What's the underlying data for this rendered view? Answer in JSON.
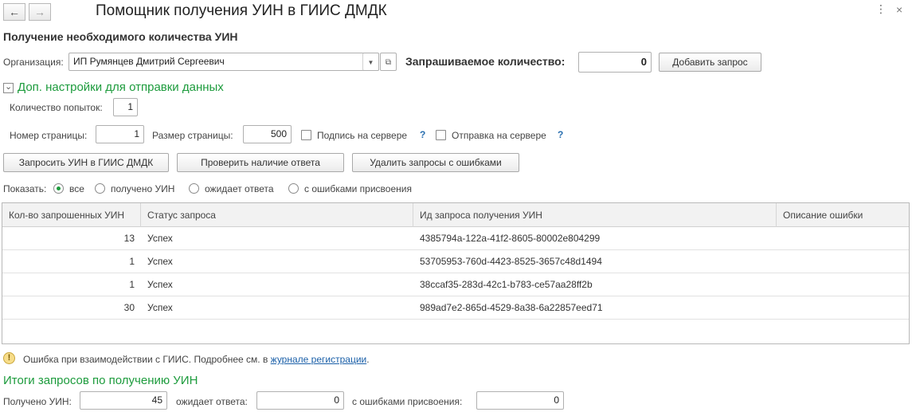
{
  "window": {
    "title": "Помощник получения УИН в ГИИС ДМДК",
    "back_icon": "arrow-left-icon",
    "forward_icon": "arrow-right-icon",
    "menu_icon": "more-vertical-icon",
    "close_icon": "close-icon"
  },
  "section": {
    "title": "Получение необходимого количества УИН"
  },
  "org": {
    "label": "Организация:",
    "value": "ИП Румянцев Дмитрий Сергеевич"
  },
  "request": {
    "qty_label": "Запрашиваемое количество:",
    "qty_value": "0",
    "add_button": "Добавить запрос"
  },
  "settings": {
    "toggle_label": "Доп. настройки для отправки данных",
    "attempts_label": "Количество попыток:",
    "attempts_value": "1",
    "page_num_label": "Номер страницы:",
    "page_num_value": "1",
    "page_size_label": "Размер страницы:",
    "page_size_value": "500",
    "sign_on_server_label": "Подпись на сервере",
    "send_on_server_label": "Отправка на сервере",
    "help_mark": "?"
  },
  "actions": {
    "request_uin": "Запросить УИН в ГИИС ДМДК",
    "check_response": "Проверить наличие ответа",
    "delete_errors": "Удалить запросы с ошибками"
  },
  "filter": {
    "label": "Показать:",
    "options": [
      "все",
      "получено УИН",
      "ожидает ответа",
      "с ошибками присвоения"
    ],
    "selected": "все"
  },
  "table": {
    "columns": [
      "Кол-во запрошенных УИН",
      "Статус запроса",
      "Ид запроса получения УИН",
      "Описание ошибки"
    ],
    "rows": [
      {
        "count": "13",
        "status": "Успех",
        "id": "4385794a-122a-41f2-8605-80002e804299",
        "error": ""
      },
      {
        "count": "1",
        "status": "Успех",
        "id": "53705953-760d-4423-8525-3657c48d1494",
        "error": ""
      },
      {
        "count": "1",
        "status": "Успех",
        "id": "38ccaf35-283d-42c1-b783-ce57aa28ff2b",
        "error": ""
      },
      {
        "count": "30",
        "status": "Успех",
        "id": "989ad7e2-865d-4529-8a38-6a22857eed71",
        "error": ""
      }
    ]
  },
  "error_notice": {
    "text": "Ошибка при взаимодействии с ГИИС. Подробнее см. в",
    "link": "журнале регистрации",
    "end": ".",
    "icon": "warning-icon"
  },
  "totals": {
    "title": "Итоги запросов по получению УИН",
    "received_label": "Получено УИН:",
    "received_value": "45",
    "waiting_label": "ожидает ответа:",
    "waiting_value": "0",
    "errors_label": "с ошибками присвоения:",
    "errors_value": "0"
  },
  "colors": {
    "accent_green": "#1c9b3c",
    "link_blue": "#1a5fa8",
    "warning_yellow": "#f7dd8a"
  }
}
